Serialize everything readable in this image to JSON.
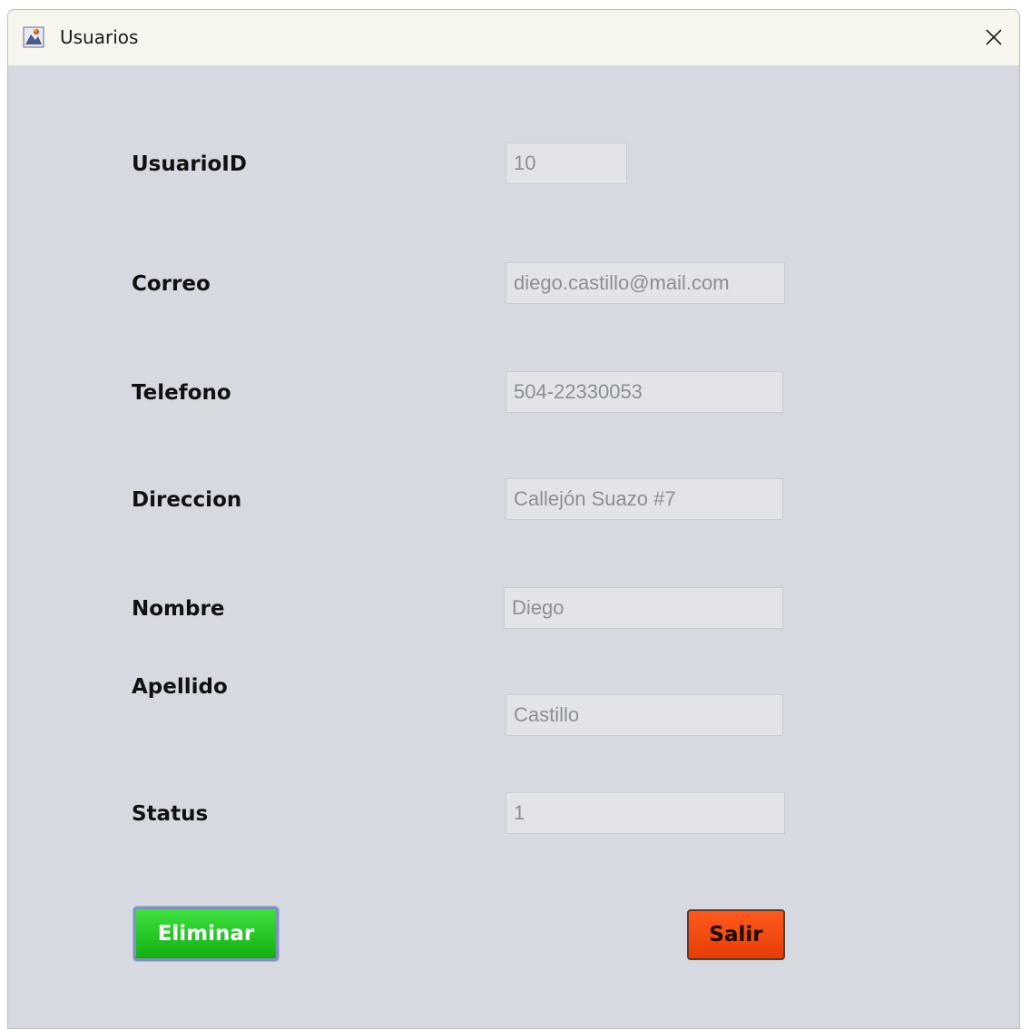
{
  "window": {
    "title": "Usuarios",
    "icon": "java-app-icon",
    "close_icon": "close-icon"
  },
  "fields": [
    {
      "label": "UsuarioID",
      "value": "10"
    },
    {
      "label": "Correo",
      "value": "diego.castillo@mail.com"
    },
    {
      "label": "Telefono",
      "value": "504-22330053"
    },
    {
      "label": "Direccion",
      "value": "Callejón Suazo #7"
    },
    {
      "label": "Nombre",
      "value": "Diego"
    },
    {
      "label": "Apellido",
      "value": "Castillo"
    },
    {
      "label": "Status",
      "value": "1"
    }
  ],
  "buttons": {
    "eliminar": "Eliminar",
    "salir": "Salir"
  },
  "colors": {
    "window_bg": "#d6d9e0",
    "titlebar_bg": "#f7f6ee",
    "eliminar_bg": "#22c722",
    "salir_bg": "#f24a10"
  }
}
